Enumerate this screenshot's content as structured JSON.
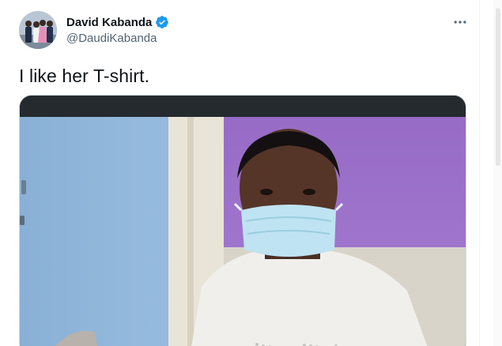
{
  "tweet": {
    "author": {
      "display_name": "David Kabanda",
      "handle": "@DaudiKabanda",
      "verified": true
    },
    "more_icon": "more-horizontal-icon",
    "text": "I like her T-shirt.",
    "media": {
      "type": "photo"
    }
  },
  "colors": {
    "verified_blue": "#1d9bf0",
    "text_primary": "#0f1419",
    "text_secondary": "#536471",
    "border": "#cfd9de"
  }
}
